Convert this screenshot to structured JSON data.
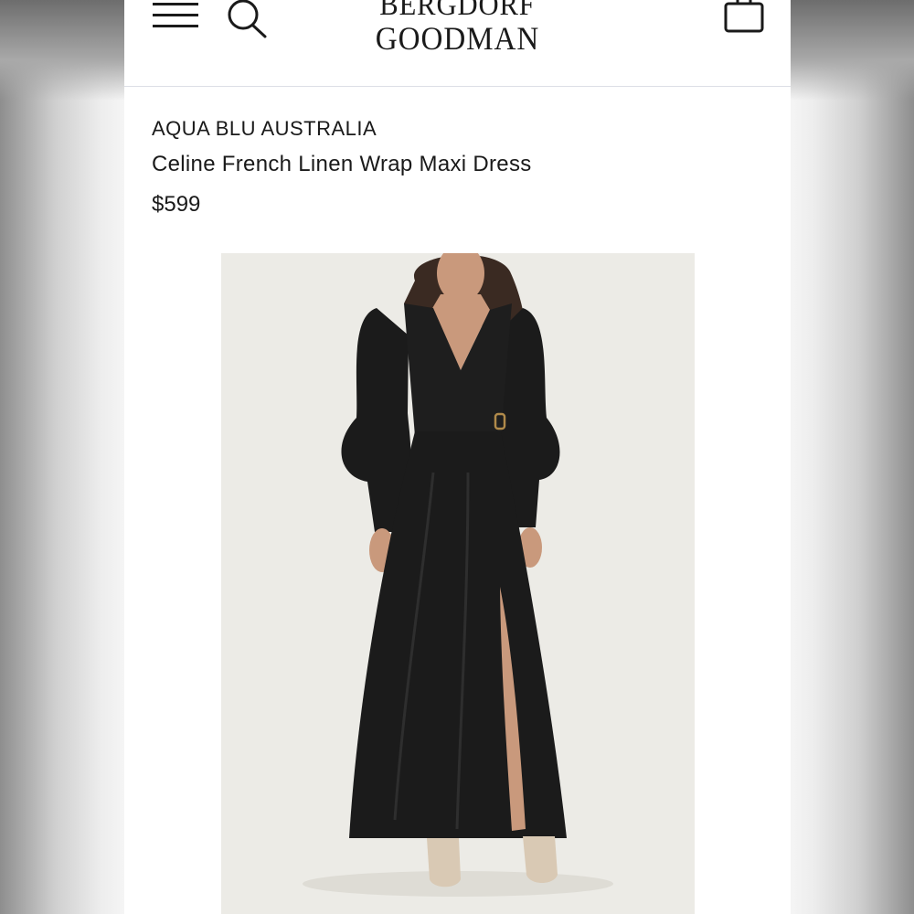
{
  "header": {
    "logo_line1": "BERGDORF",
    "logo_line2": "GOODMAN",
    "menu_icon": "hamburger-menu-icon",
    "search_icon": "search-icon",
    "bag_icon": "shopping-bag-icon"
  },
  "product": {
    "brand": "AQUA BLU AUSTRALIA",
    "name": "Celine French Linen Wrap Maxi Dress",
    "price": "$599"
  },
  "colors": {
    "text": "#1a1a1a",
    "image_background": "#ecebe6",
    "dress": "#1b1b1b"
  }
}
